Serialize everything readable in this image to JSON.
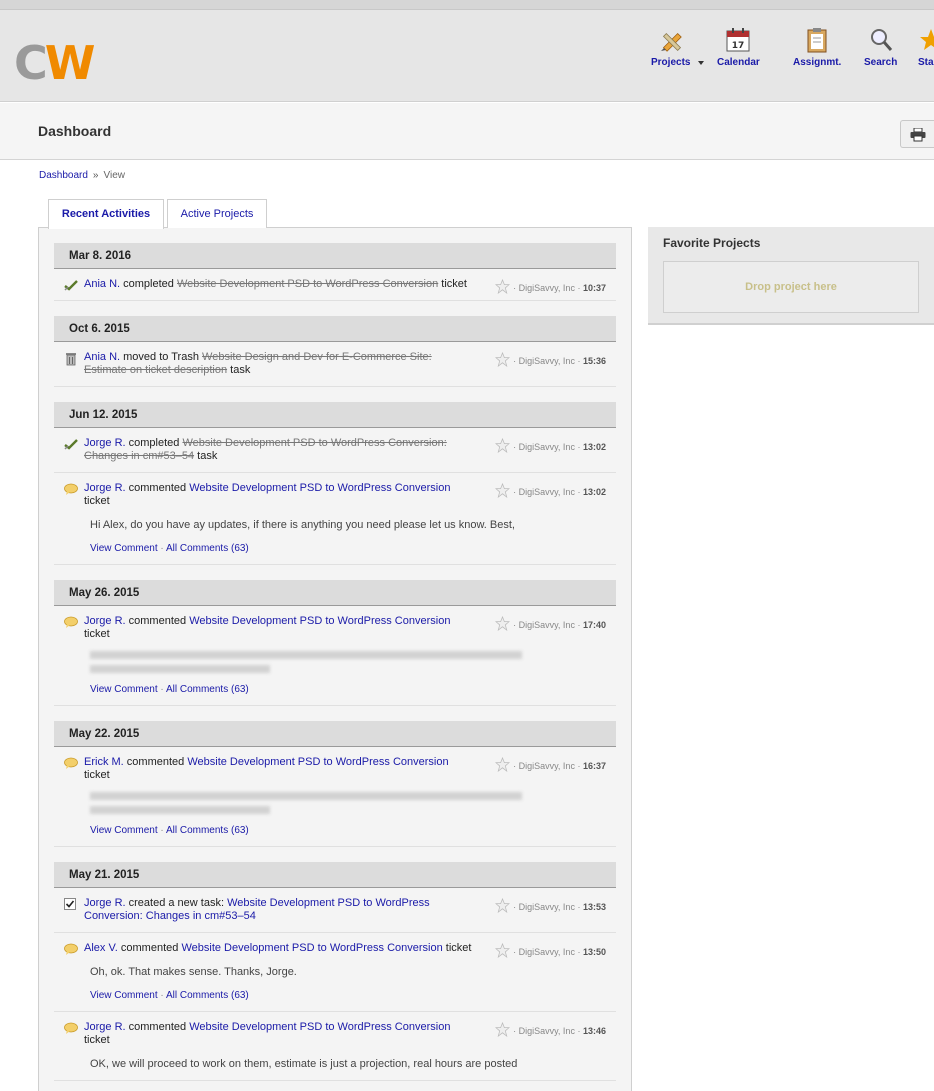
{
  "app": {
    "logo_c": "C",
    "logo_w": "W"
  },
  "nav": [
    {
      "label": "Projects",
      "icon": "pencil-ruler-icon"
    },
    {
      "label": "Calendar",
      "icon": "calendar-icon",
      "day": "17"
    },
    {
      "label": "Assignmt.",
      "icon": "clipboard-icon"
    },
    {
      "label": "Search",
      "icon": "magnifier-icon"
    },
    {
      "label": "Sta",
      "icon": "star-icon"
    }
  ],
  "page": {
    "title": "Dashboard"
  },
  "breadcrumb": {
    "root": "Dashboard",
    "sep": "»",
    "current": "View"
  },
  "tabs": [
    "Recent Activities",
    "Active Projects"
  ],
  "favorites": {
    "title": "Favorite Projects",
    "drop_hint": "Drop project here"
  },
  "activity_days": [
    {
      "date": "Mar 8. 2016",
      "items": [
        {
          "icon": "check-icon",
          "user": "Ania N.",
          "verb": "completed",
          "target": "Website Development PSD to WordPress Conversion",
          "struck": true,
          "suffix": "ticket",
          "company": "· DigiSavvy, Inc ·",
          "time": "10:37"
        }
      ]
    },
    {
      "date": "Oct 6. 2015",
      "items": [
        {
          "icon": "trash-icon",
          "user": "Ania N.",
          "verb": "moved to Trash",
          "target": "Website Design and Dev for E-Commerce Site: Estimate on ticket description",
          "struck": true,
          "suffix": "task",
          "company": "· DigiSavvy, Inc ·",
          "time": "15:36"
        }
      ]
    },
    {
      "date": "Jun 12. 2015",
      "items": [
        {
          "icon": "check-icon",
          "user": "Jorge R.",
          "verb": "completed",
          "target": "Website Development PSD to WordPress Conversion: Changes in cm#53–54",
          "struck": true,
          "suffix": "task",
          "company": "· DigiSavvy, Inc ·",
          "time": "13:02"
        },
        {
          "icon": "comment-icon",
          "user": "Jorge R.",
          "verb": "commented",
          "target": "Website Development PSD to WordPress Conversion",
          "struck": false,
          "suffix": "ticket",
          "company": "· DigiSavvy, Inc ·",
          "time": "13:02",
          "quote": "Hi Alex, do you have ay updates, if there is anything you need  please let us know. Best,",
          "view_comment": "View Comment",
          "all_comments": "All Comments (63)"
        }
      ]
    },
    {
      "date": "May 26. 2015",
      "items": [
        {
          "icon": "comment-icon",
          "user": "Jorge R.",
          "verb": "commented",
          "target": "Website Development PSD to WordPress Conversion",
          "struck": false,
          "suffix": "ticket",
          "company": "· DigiSavvy, Inc ·",
          "time": "17:40",
          "blurred": true,
          "view_comment": "View Comment",
          "all_comments": "All Comments (63)"
        }
      ]
    },
    {
      "date": "May 22. 2015",
      "items": [
        {
          "icon": "comment-icon",
          "user": "Erick M.",
          "verb": "commented",
          "target": "Website Development PSD to WordPress Conversion",
          "struck": false,
          "suffix": "ticket",
          "company": "· DigiSavvy, Inc ·",
          "time": "16:37",
          "blurred": true,
          "view_comment": "View Comment",
          "all_comments": "All Comments (63)"
        }
      ]
    },
    {
      "date": "May 21. 2015",
      "items": [
        {
          "icon": "task-icon",
          "user": "Jorge R.",
          "verb": "created a new task:",
          "target": "Website Development PSD to WordPress Conversion: Changes in cm#53–54",
          "struck": false,
          "suffix": "",
          "company": "· DigiSavvy, Inc ·",
          "time": "13:53"
        },
        {
          "icon": "comment-icon",
          "user": "Alex V.",
          "verb": "commented",
          "target": "Website Development PSD to WordPress Conversion",
          "struck": false,
          "suffix": "ticket",
          "company": "· DigiSavvy, Inc ·",
          "time": "13:50",
          "quote": "Oh, ok. That makes sense. Thanks, Jorge.",
          "view_comment": "View Comment",
          "all_comments": "All Comments (63)"
        },
        {
          "icon": "comment-icon",
          "user": "Jorge R.",
          "verb": "commented",
          "target": "Website Development PSD to WordPress Conversion",
          "struck": false,
          "suffix": "ticket",
          "company": "· DigiSavvy, Inc ·",
          "time": "13:46",
          "quote": "OK, we will proceed to work on them, estimate is just a projection, real hours are posted"
        }
      ]
    }
  ]
}
